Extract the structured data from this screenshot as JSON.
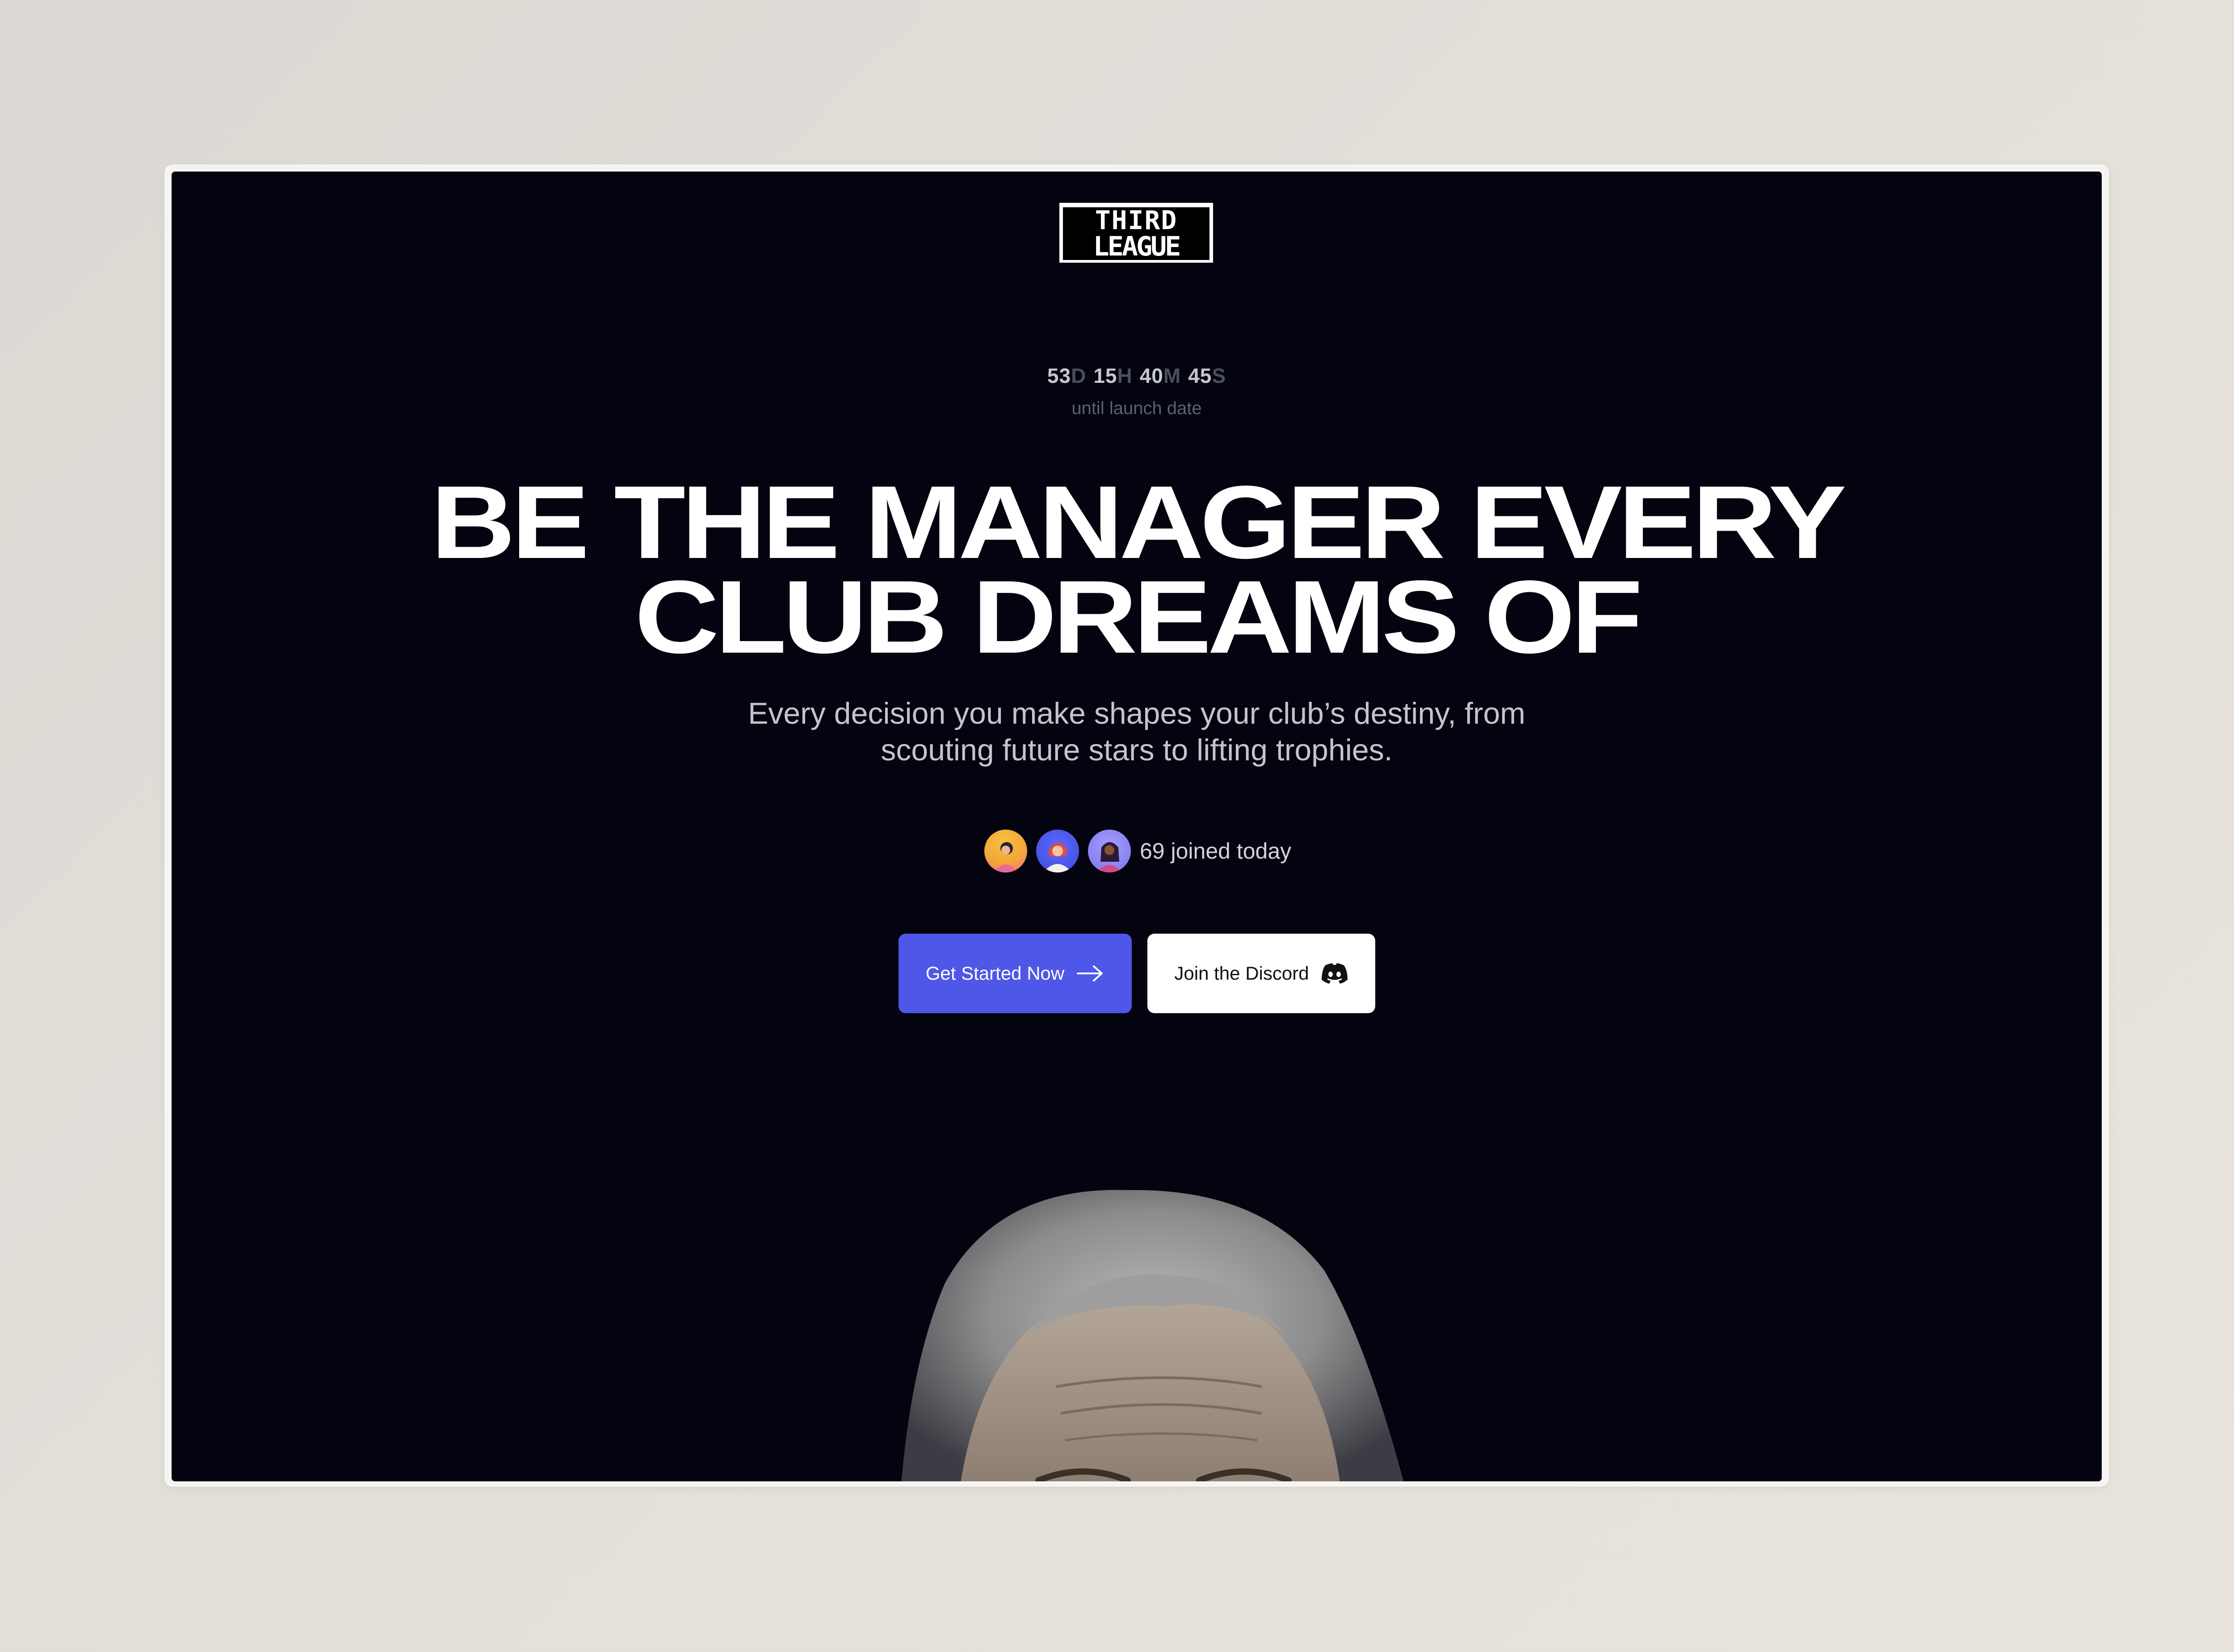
{
  "logo": {
    "line1": "THIRD",
    "line2": "LEAGUE"
  },
  "countdown": {
    "days": "53",
    "days_unit": "D",
    "hours": "15",
    "hours_unit": "H",
    "minutes": "40",
    "minutes_unit": "M",
    "seconds": "45",
    "seconds_unit": "S",
    "label": "until launch date"
  },
  "hero": {
    "headline_line1": "BE THE MANAGER EVERY",
    "headline_line2": "CLUB DREAMS OF",
    "subtitle_line1": "Every decision you make shapes your club’s destiny, from",
    "subtitle_line2": "scouting future stars to lifting trophies."
  },
  "social_proof": {
    "joined_text": "69 joined today"
  },
  "buttons": {
    "primary_label": "Get Started Now",
    "secondary_label": "Join the Discord"
  },
  "colors": {
    "page_background": "#e0dcd6",
    "screen_background": "#03040f",
    "primary_button": "#4f57e8",
    "secondary_button": "#ffffff"
  },
  "icons": {
    "primary_button_icon": "arrow-right-icon",
    "secondary_button_icon": "discord-icon"
  }
}
